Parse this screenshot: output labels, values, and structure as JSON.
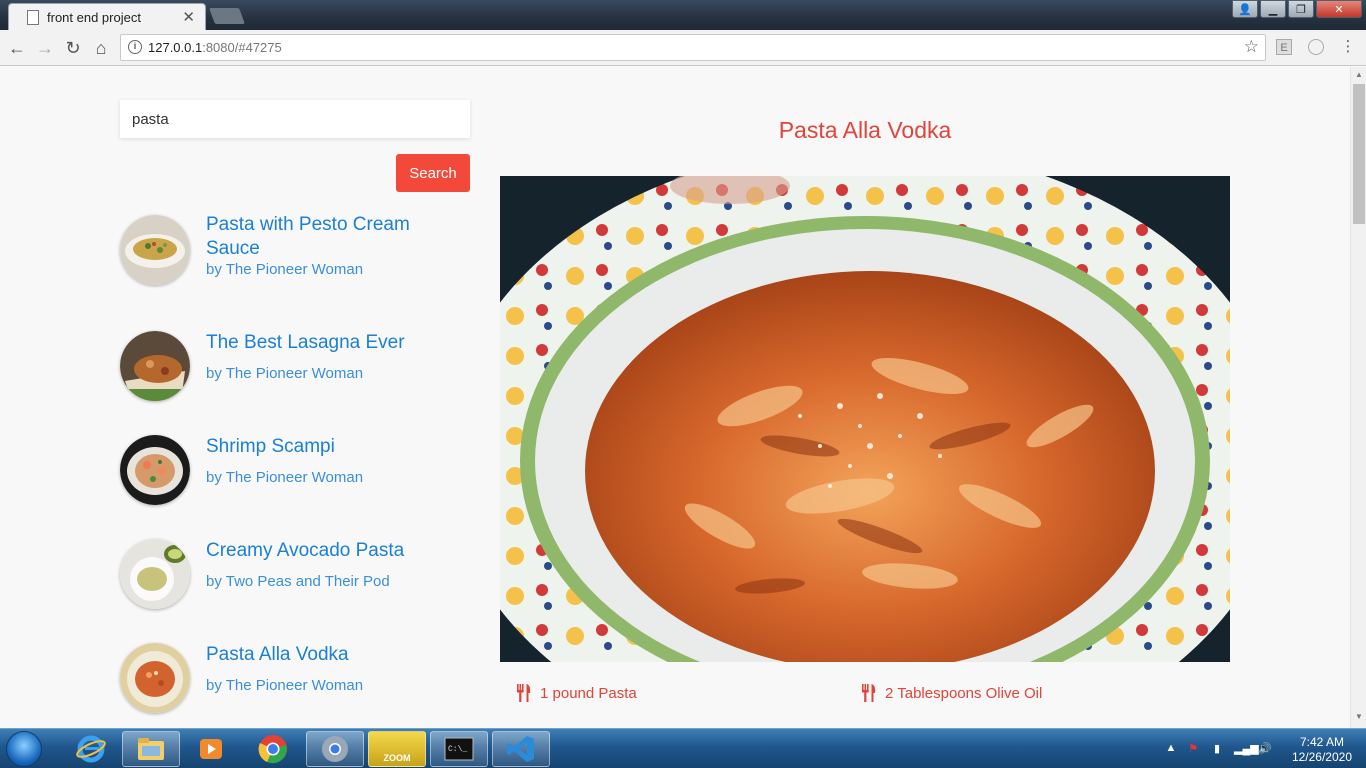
{
  "browser": {
    "tab_title": "front end project",
    "tab_close": "✕",
    "url_host": "127.0.0.1",
    "url_rest": ":8080/#47275",
    "ext1": "E"
  },
  "search": {
    "value": "pasta",
    "button_label": "Search"
  },
  "results": [
    {
      "title": "Pasta with Pesto Cream Sauce",
      "author": "by The Pioneer Woman"
    },
    {
      "title": "The Best Lasagna Ever",
      "author": "by The Pioneer Woman"
    },
    {
      "title": "Shrimp Scampi",
      "author": "by The Pioneer Woman"
    },
    {
      "title": "Creamy Avocado Pasta",
      "author": "by Two Peas and Their Pod"
    },
    {
      "title": "Pasta Alla Vodka",
      "author": "by The Pioneer Woman"
    }
  ],
  "recipe": {
    "title": "Pasta Alla Vodka",
    "ingredients": [
      "1 pound Pasta",
      "2 Tablespoons Olive Oil"
    ]
  },
  "taskbar": {
    "time": "7:42 AM",
    "date": "12/26/2020",
    "zoom_label": "ZOOM"
  },
  "colors": {
    "accent_red": "#e0443a",
    "link_blue": "#1a7fd6"
  }
}
